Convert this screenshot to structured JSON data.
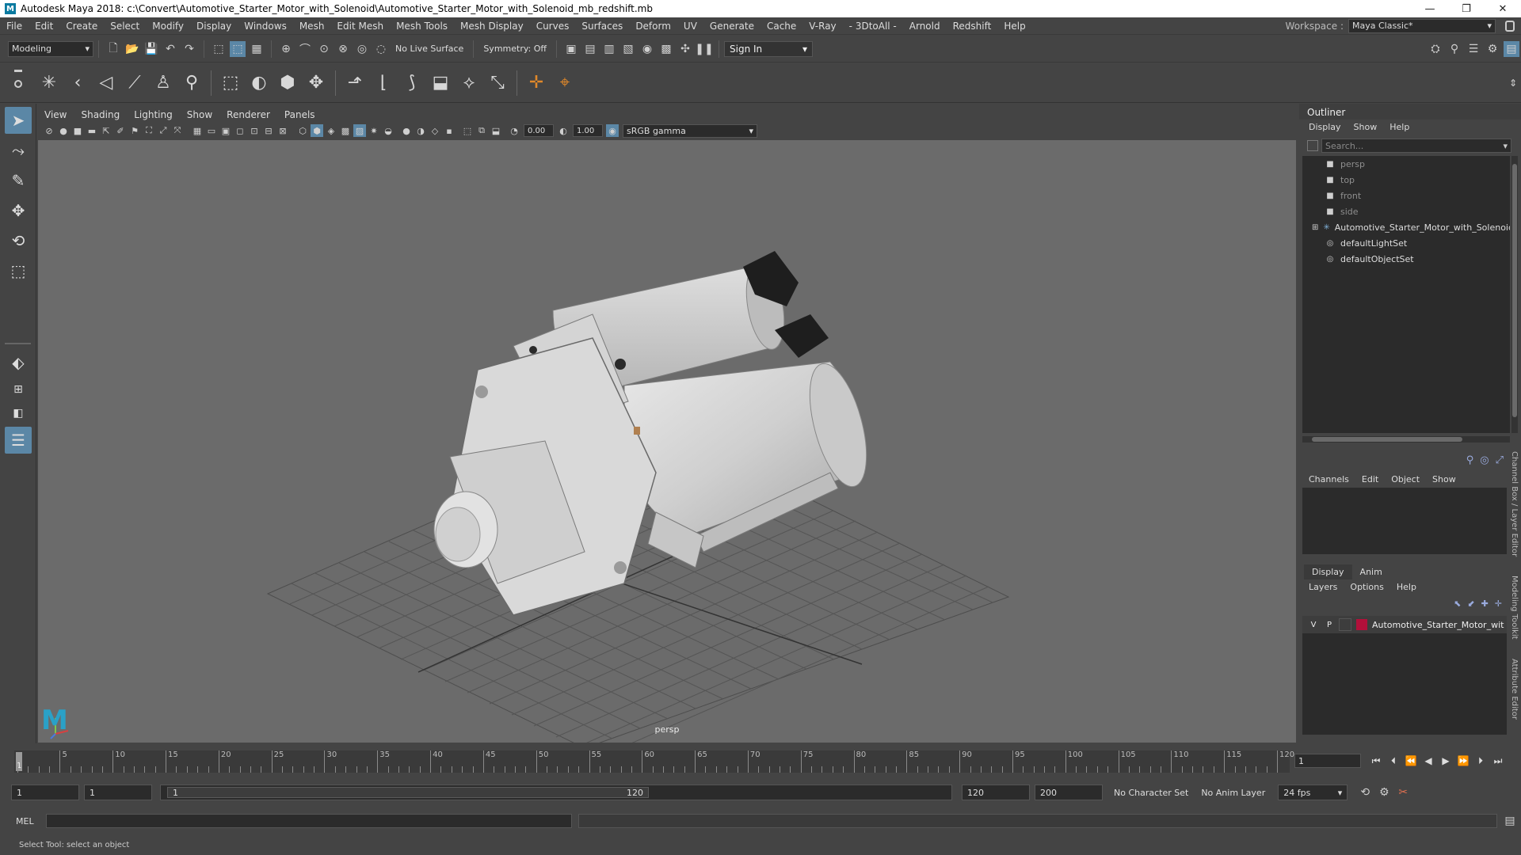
{
  "window": {
    "logo": "M",
    "title": "Autodesk Maya 2018: c:\\Convert\\Automotive_Starter_Motor_with_Solenoid\\Automotive_Starter_Motor_with_Solenoid_mb_redshift.mb",
    "minimize": "—",
    "maximize": "❐",
    "close": "✕"
  },
  "menubar": {
    "items": [
      "File",
      "Edit",
      "Create",
      "Select",
      "Modify",
      "Display",
      "Windows",
      "Mesh",
      "Edit Mesh",
      "Mesh Tools",
      "Mesh Display",
      "Curves",
      "Surfaces",
      "Deform",
      "UV",
      "Generate",
      "Cache",
      "V-Ray",
      "- 3DtoAll -",
      "Arnold",
      "Redshift",
      "Help"
    ],
    "workspace_label": "Workspace :",
    "workspace_value": "Maya Classic*"
  },
  "statusline": {
    "mode": "Modeling",
    "live_surface": "No Live Surface",
    "symmetry": "Symmetry: Off",
    "sign_in": "Sign In"
  },
  "viewport_panel": {
    "menu": [
      "View",
      "Shading",
      "Lighting",
      "Show",
      "Renderer",
      "Panels"
    ],
    "exposure": "0.00",
    "gamma": "1.00",
    "color_space": "sRGB gamma",
    "camera_label": "persp"
  },
  "outliner": {
    "title": "Outliner",
    "menu": [
      "Display",
      "Show",
      "Help"
    ],
    "search_placeholder": "Search...",
    "items": [
      {
        "label": "persp",
        "icon": "camera-icon",
        "dim": true
      },
      {
        "label": "top",
        "icon": "camera-icon",
        "dim": true
      },
      {
        "label": "front",
        "icon": "camera-icon",
        "dim": true
      },
      {
        "label": "side",
        "icon": "camera-icon",
        "dim": true
      },
      {
        "label": "Automotive_Starter_Motor_with_Solenoid",
        "icon": "group-icon",
        "dim": false
      },
      {
        "label": "defaultLightSet",
        "icon": "set-icon",
        "dim": false
      },
      {
        "label": "defaultObjectSet",
        "icon": "set-icon",
        "dim": false
      }
    ]
  },
  "channelbox": {
    "menu": [
      "Channels",
      "Edit",
      "Object",
      "Show"
    ]
  },
  "layereditor": {
    "tabs": [
      "Display",
      "Anim"
    ],
    "menu": [
      "Layers",
      "Options",
      "Help"
    ],
    "layer": {
      "v": "V",
      "p": "P",
      "name": "Automotive_Starter_Motor_wit",
      "color": "#b3103a"
    }
  },
  "side_tabs": [
    "Channel Box / Layer Editor",
    "Modeling Toolkit",
    "Attribute Editor"
  ],
  "timeline": {
    "ticks": [
      "5",
      "10",
      "15",
      "20",
      "25",
      "30",
      "35",
      "40",
      "45",
      "50",
      "55",
      "60",
      "65",
      "70",
      "75",
      "80",
      "85",
      "90",
      "95",
      "100",
      "105",
      "110",
      "115",
      "120"
    ],
    "current_frame": "1",
    "current_field": "1"
  },
  "rangebar": {
    "start": "1",
    "playback_start": "1",
    "slider_start": "1",
    "slider_end": "120",
    "playback_end": "120",
    "end": "200",
    "character_set": "No Character Set",
    "anim_layer": "No Anim Layer",
    "fps": "24 fps"
  },
  "cmdline": {
    "label": "MEL"
  },
  "helpline": {
    "text": "Select Tool: select an object"
  }
}
